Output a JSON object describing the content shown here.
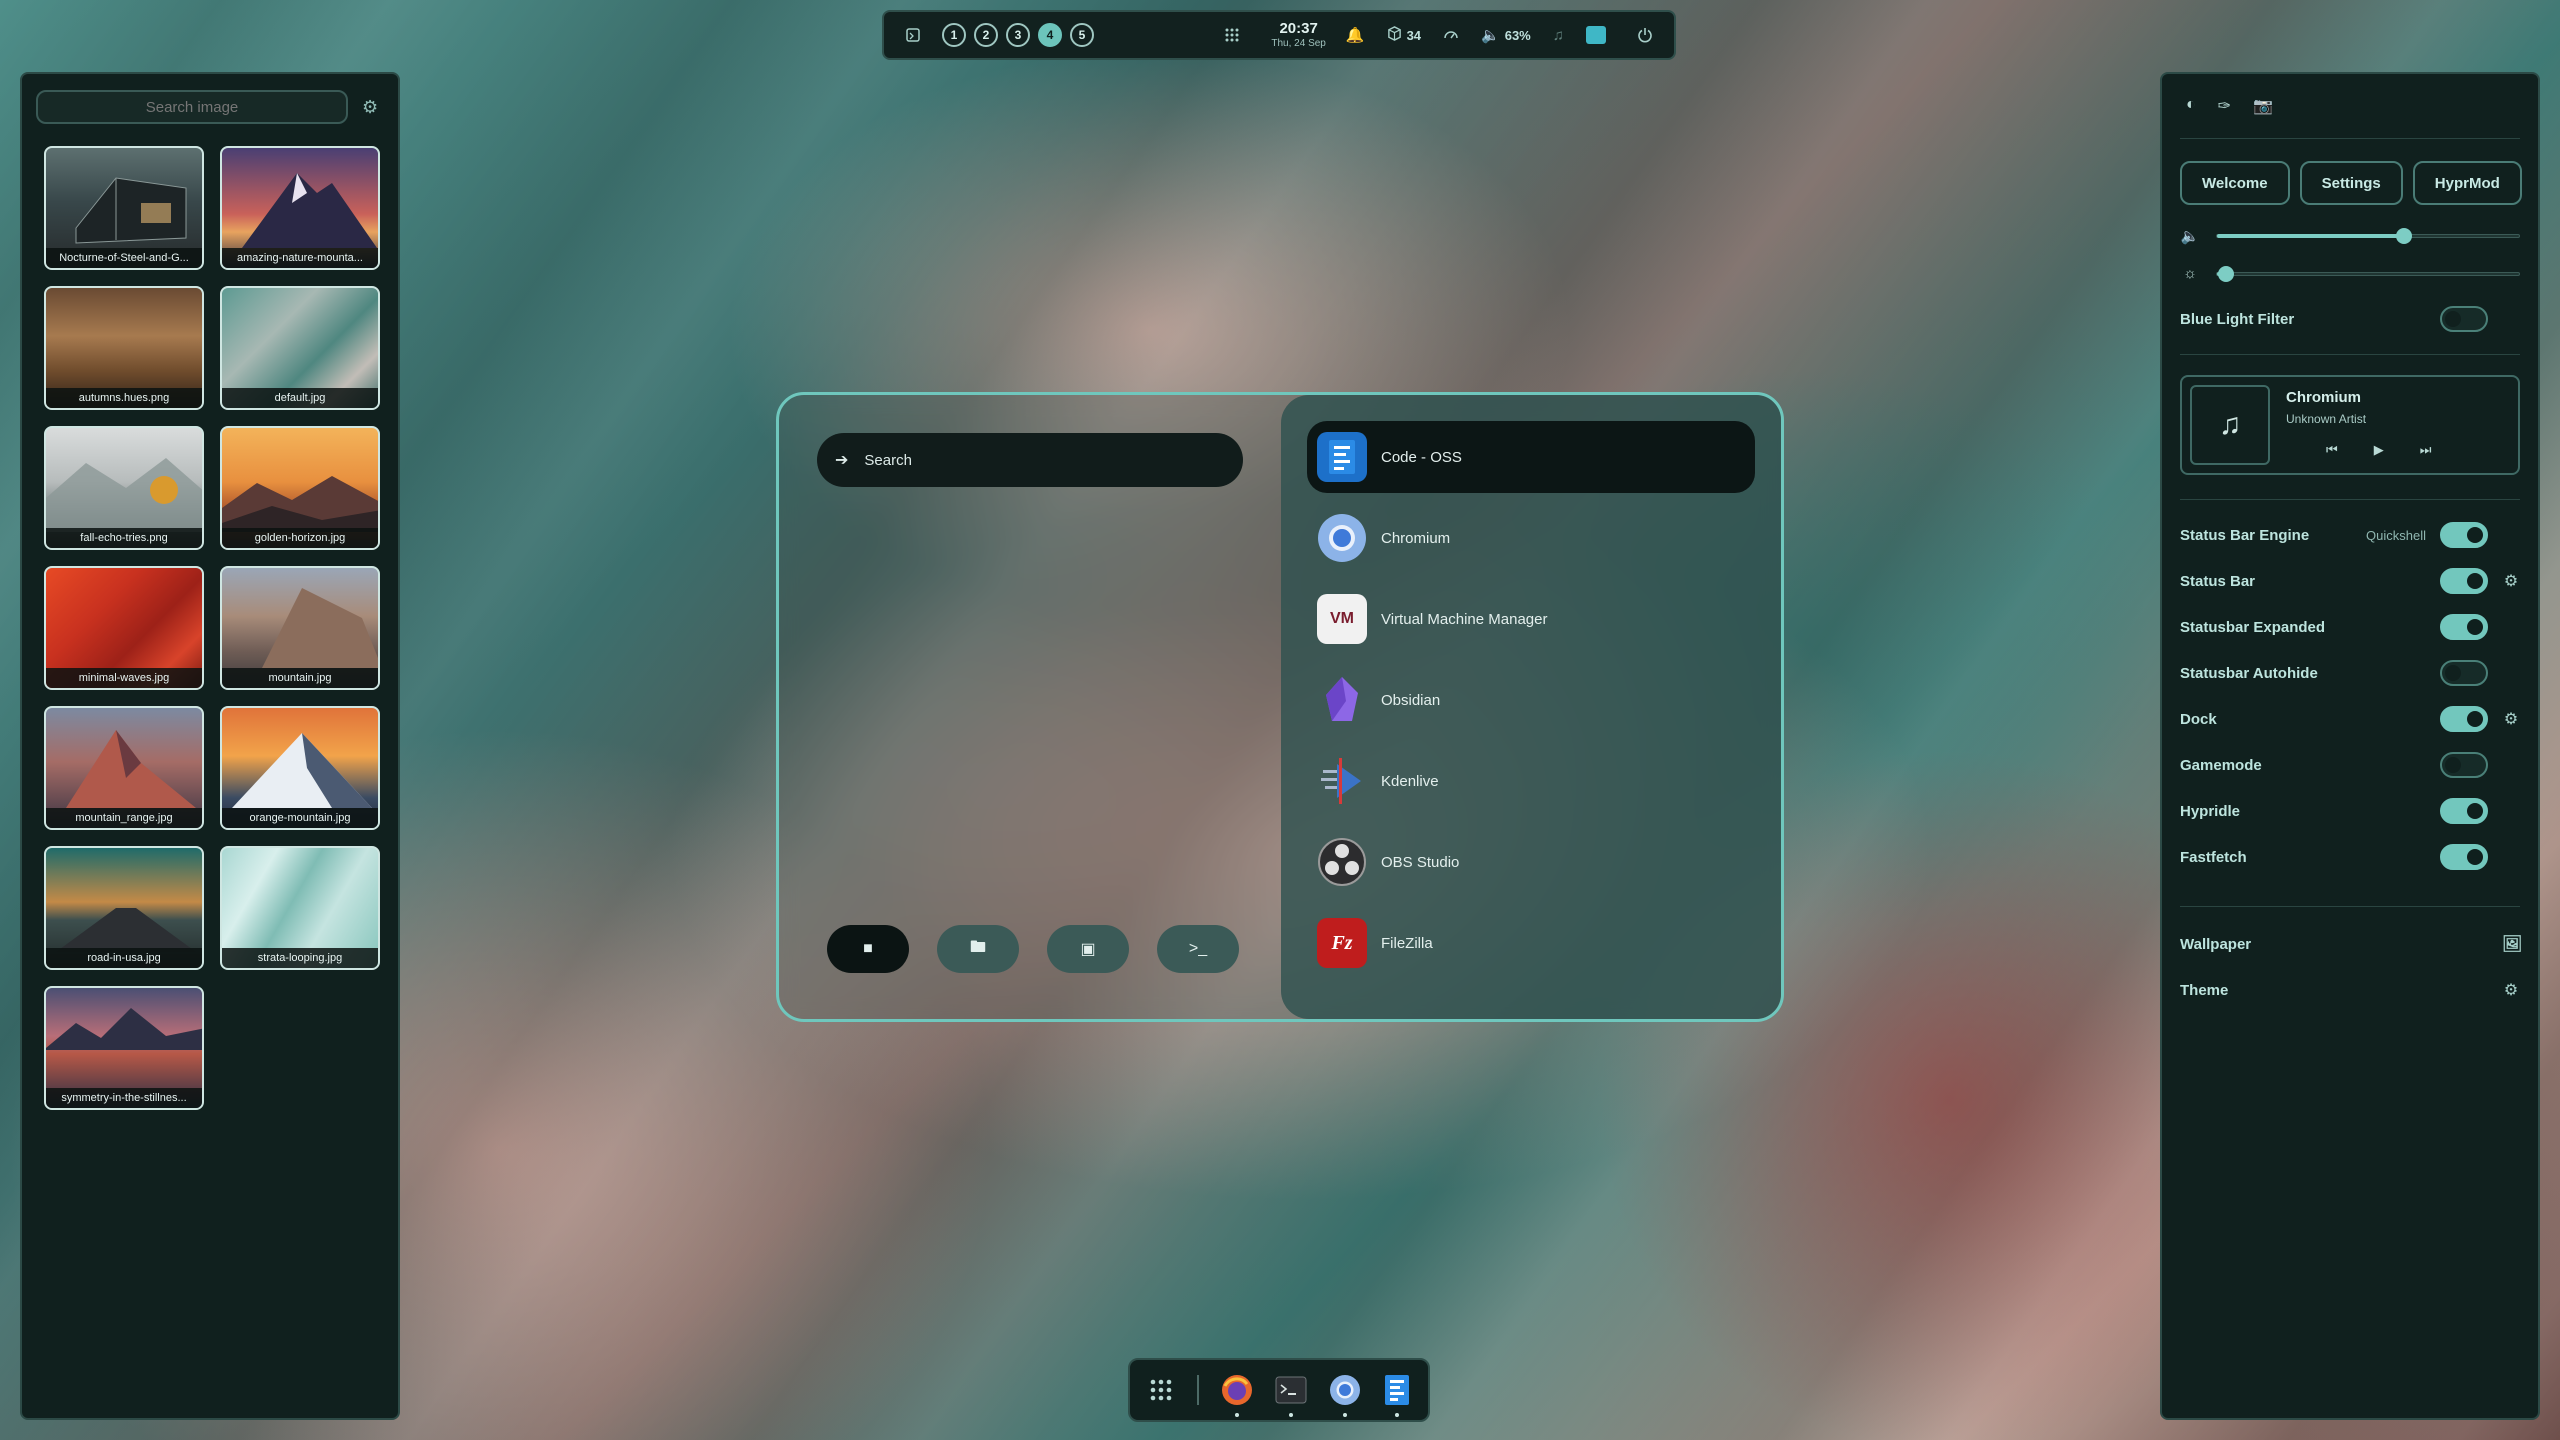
{
  "topbar": {
    "workspaces": [
      "1",
      "2",
      "3",
      "4",
      "5"
    ],
    "active_workspace": "4",
    "time": "20:37",
    "date": "Thu, 24 Sep",
    "updates": "34",
    "volume": "63%"
  },
  "wallpapers": {
    "search_placeholder": "Search image",
    "items": [
      "Nocturne-of-Steel-and-G...",
      "amazing-nature-mounta...",
      "autumns.hues.png",
      "default.jpg",
      "fall-echo-tries.png",
      "golden-horizon.jpg",
      "minimal-waves.jpg",
      "mountain.jpg",
      "mountain_range.jpg",
      "orange-mountain.jpg",
      "road-in-usa.jpg",
      "strata-looping.jpg",
      "symmetry-in-the-stillnes..."
    ]
  },
  "launcher": {
    "search_placeholder": "Search",
    "apps": [
      "Code - OSS",
      "Chromium",
      "Virtual Machine Manager",
      "Obsidian",
      "Kdenlive",
      "OBS Studio",
      "FileZilla"
    ],
    "active_app": "Code - OSS"
  },
  "panel": {
    "buttons": [
      "Welcome",
      "Settings",
      "HyprMod"
    ],
    "volume_level": 0.62,
    "brightness_level": 0.03,
    "blue_light_label": "Blue Light Filter",
    "media": {
      "title": "Chromium",
      "artist": "Unknown Artist"
    },
    "toggles": [
      {
        "label": "Status Bar Engine",
        "sub": "Quickshell",
        "on": true,
        "gear": false
      },
      {
        "label": "Status Bar",
        "sub": "",
        "on": true,
        "gear": true
      },
      {
        "label": "Statusbar Expanded",
        "sub": "",
        "on": true,
        "gear": false
      },
      {
        "label": "Statusbar Autohide",
        "sub": "",
        "on": false,
        "gear": false
      },
      {
        "label": "Dock",
        "sub": "",
        "on": true,
        "gear": true
      },
      {
        "label": "Gamemode",
        "sub": "",
        "on": false,
        "gear": false
      },
      {
        "label": "Hypridle",
        "sub": "",
        "on": true,
        "gear": false
      },
      {
        "label": "Fastfetch",
        "sub": "",
        "on": true,
        "gear": false
      }
    ],
    "wallpaper_label": "Wallpaper",
    "theme_label": "Theme"
  },
  "colors": {
    "accent": "#6cc4bb",
    "panel": "#10201e"
  }
}
